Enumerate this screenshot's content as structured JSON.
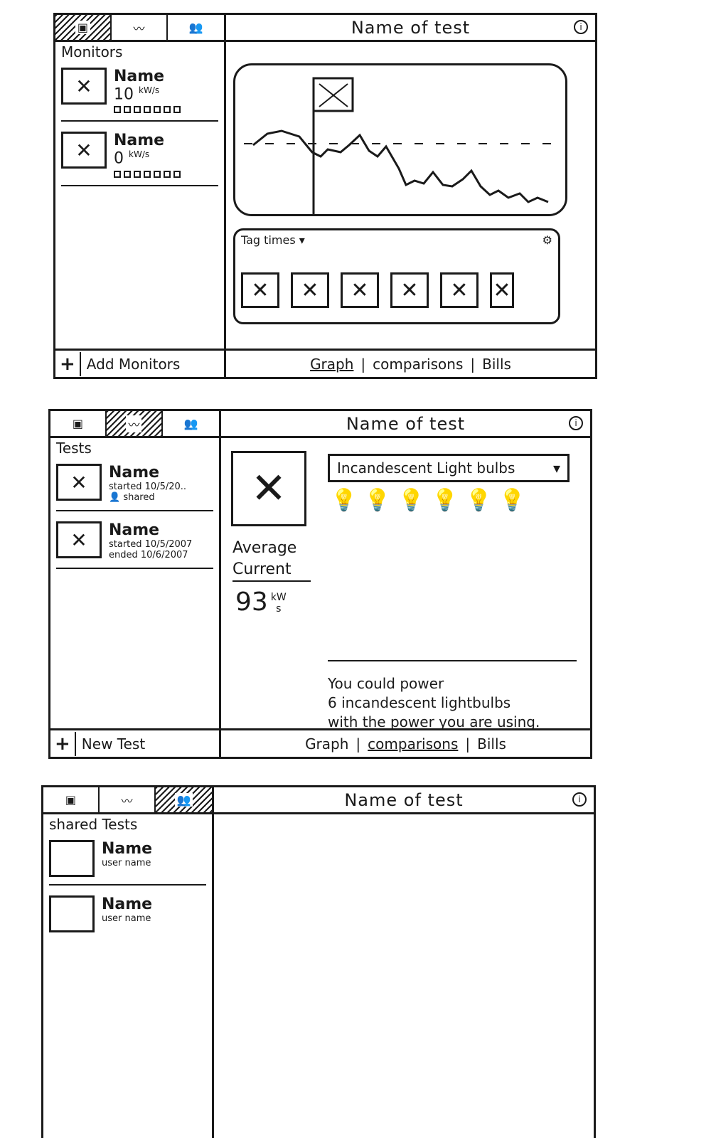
{
  "screens": [
    {
      "header": {
        "title": "Name of test"
      },
      "sidebar": {
        "title": "Monitors",
        "monitors": [
          {
            "name": "Name",
            "power": "10",
            "unit": "kW/s"
          },
          {
            "name": "Name",
            "power": "0",
            "unit": "kW/s"
          }
        ]
      },
      "graph": {
        "tag_panel_title": "Tag times ▾",
        "gear_icon": "gear-icon",
        "thumbnail_count": 6
      },
      "footer": {
        "add_label": "Add Monitors",
        "tabs": [
          "Graph",
          "comparisons",
          "Bills"
        ],
        "active_tab": "Graph"
      }
    },
    {
      "header": {
        "title": "Name of test"
      },
      "sidebar": {
        "title": "Tests",
        "tests": [
          {
            "name": "Name",
            "started": "started 10/5/20..",
            "status": "shared"
          },
          {
            "name": "Name",
            "started": "started 10/5/2007",
            "ended": "ended 10/6/2007"
          }
        ]
      },
      "comparison": {
        "average_label": "Average Current",
        "average_value": "93",
        "unit_top": "kW",
        "unit_bottom": "s",
        "dropdown_value": "Incandescent Light bulbs",
        "bulb_count": 6,
        "statement_line1": "You could power",
        "statement_line2": "6 incandescent lightbulbs",
        "statement_line3": "with the power you are using."
      },
      "footer": {
        "add_label": "New Test",
        "tabs": [
          "Graph",
          "comparisons",
          "Bills"
        ],
        "active_tab": "comparisons"
      }
    },
    {
      "header": {
        "title": "Name of test"
      },
      "sidebar": {
        "title": "shared Tests",
        "shared_tests": [
          {
            "name": "Name",
            "user": "user name"
          },
          {
            "name": "Name",
            "user": "user name"
          }
        ]
      }
    }
  ]
}
